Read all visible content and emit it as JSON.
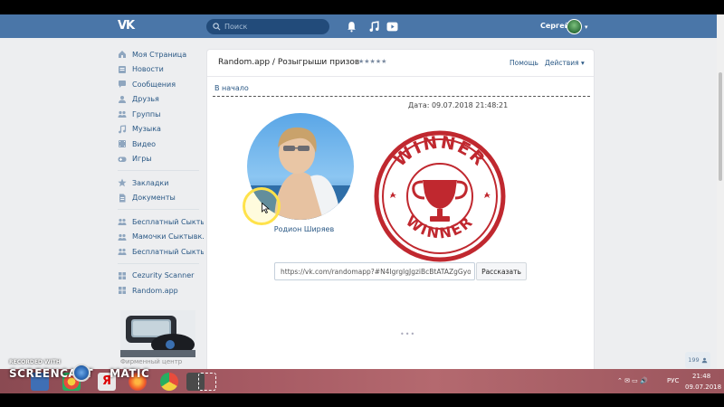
{
  "header": {
    "logo": "VK",
    "search_placeholder": "Поиск",
    "user_name": "Сергей",
    "icons": [
      "bell-icon",
      "music-icon",
      "video-icon"
    ]
  },
  "sidebar": {
    "items": [
      {
        "label": "Моя Страница",
        "icon": "home-icon"
      },
      {
        "label": "Новости",
        "icon": "news-icon"
      },
      {
        "label": "Сообщения",
        "icon": "messages-icon"
      },
      {
        "label": "Друзья",
        "icon": "friends-icon"
      },
      {
        "label": "Группы",
        "icon": "groups-icon"
      },
      {
        "label": "Музыка",
        "icon": "music-icon"
      },
      {
        "label": "Видео",
        "icon": "video-icon"
      },
      {
        "label": "Игры",
        "icon": "games-icon"
      }
    ],
    "items2": [
      {
        "label": "Закладки",
        "icon": "star-icon"
      },
      {
        "label": "Документы",
        "icon": "document-icon"
      }
    ],
    "items3": [
      {
        "label": "Бесплатный Сыктыв...",
        "icon": "groups-icon"
      },
      {
        "label": "Мамочки Сыктывк...",
        "icon": "groups-icon"
      },
      {
        "label": "Бесплатный Сыкты...",
        "icon": "groups-icon"
      }
    ],
    "items4": [
      {
        "label": "Cezurity Scanner",
        "icon": "app-icon"
      },
      {
        "label": "Random.app",
        "icon": "app-icon"
      }
    ],
    "ad_caption": "Фирменный центр"
  },
  "app": {
    "title": "Random.app / Розыгрыши призов",
    "stars": "★★★★★",
    "help": "Помощь",
    "actions": "Действия",
    "back": "В начало",
    "date": "Дата: 09.07.2018 21:48:21",
    "winner_name": "Родион Ширяев",
    "stamp_text": "WINNER",
    "url": "https://vk.com/randomapp?#N4IgrglgJgziBcBtATAZgGyo",
    "share_label": "Рассказать",
    "loader": "•••"
  },
  "corner_badge": "199",
  "taskbar": {
    "lang": "РУС",
    "time": "21:48",
    "date": "09.07.2018"
  },
  "watermark": {
    "small": "RECORDED WITH",
    "big_left": "SCREENCAST",
    "big_right": "MATIC"
  },
  "colors": {
    "header": "#4a76a8",
    "link": "#2a5885",
    "stamp": "#c0282f",
    "taskbar": "#a65a63"
  }
}
